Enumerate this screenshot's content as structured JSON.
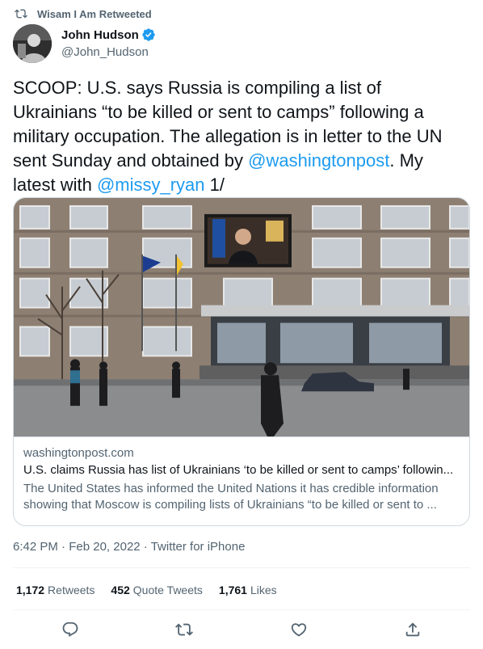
{
  "retweet_banner": {
    "icon": "retweet-icon",
    "text": "Wisam I Am Retweeted"
  },
  "author": {
    "name": "John Hudson",
    "handle": "@John_Hudson",
    "verified": true,
    "verified_color": "#1d9bf0"
  },
  "tweet": {
    "text_before": "SCOOP: U.S. says Russia is compiling a list of Ukrainians “to be killed or sent to camps” following a military occupation. The allegation is in letter to the UN sent Sunday and obtained by ",
    "mention1": "@washingtonpost",
    "text_middle": ". My latest with ",
    "mention2": "@missy_ryan",
    "text_after": " 1/"
  },
  "link_card": {
    "domain": "washingtonpost.com",
    "title": "U.S. claims Russia has list of Ukrainians ‘to be killed or sent to camps’ followin...",
    "description": "The United States has informed the United Nations it has credible information showing that Moscow is compiling lists of Ukrainians “to be killed or sent to ..."
  },
  "meta": {
    "time": "6:42 PM",
    "separator1": " · ",
    "date": "Feb 20, 2022",
    "separator2": " · ",
    "source": "Twitter for iPhone"
  },
  "stats": {
    "retweets_count": "1,172",
    "retweets_label": "Retweets",
    "quotes_count": "452",
    "quotes_label": "Quote Tweets",
    "likes_count": "1,761",
    "likes_label": "Likes"
  },
  "actions": [
    "reply-icon",
    "retweet-icon",
    "like-icon",
    "share-icon"
  ],
  "colors": {
    "accent": "#1d9bf0",
    "text": "#0f1419",
    "secondary": "#536471",
    "border": "#cfd9de"
  }
}
